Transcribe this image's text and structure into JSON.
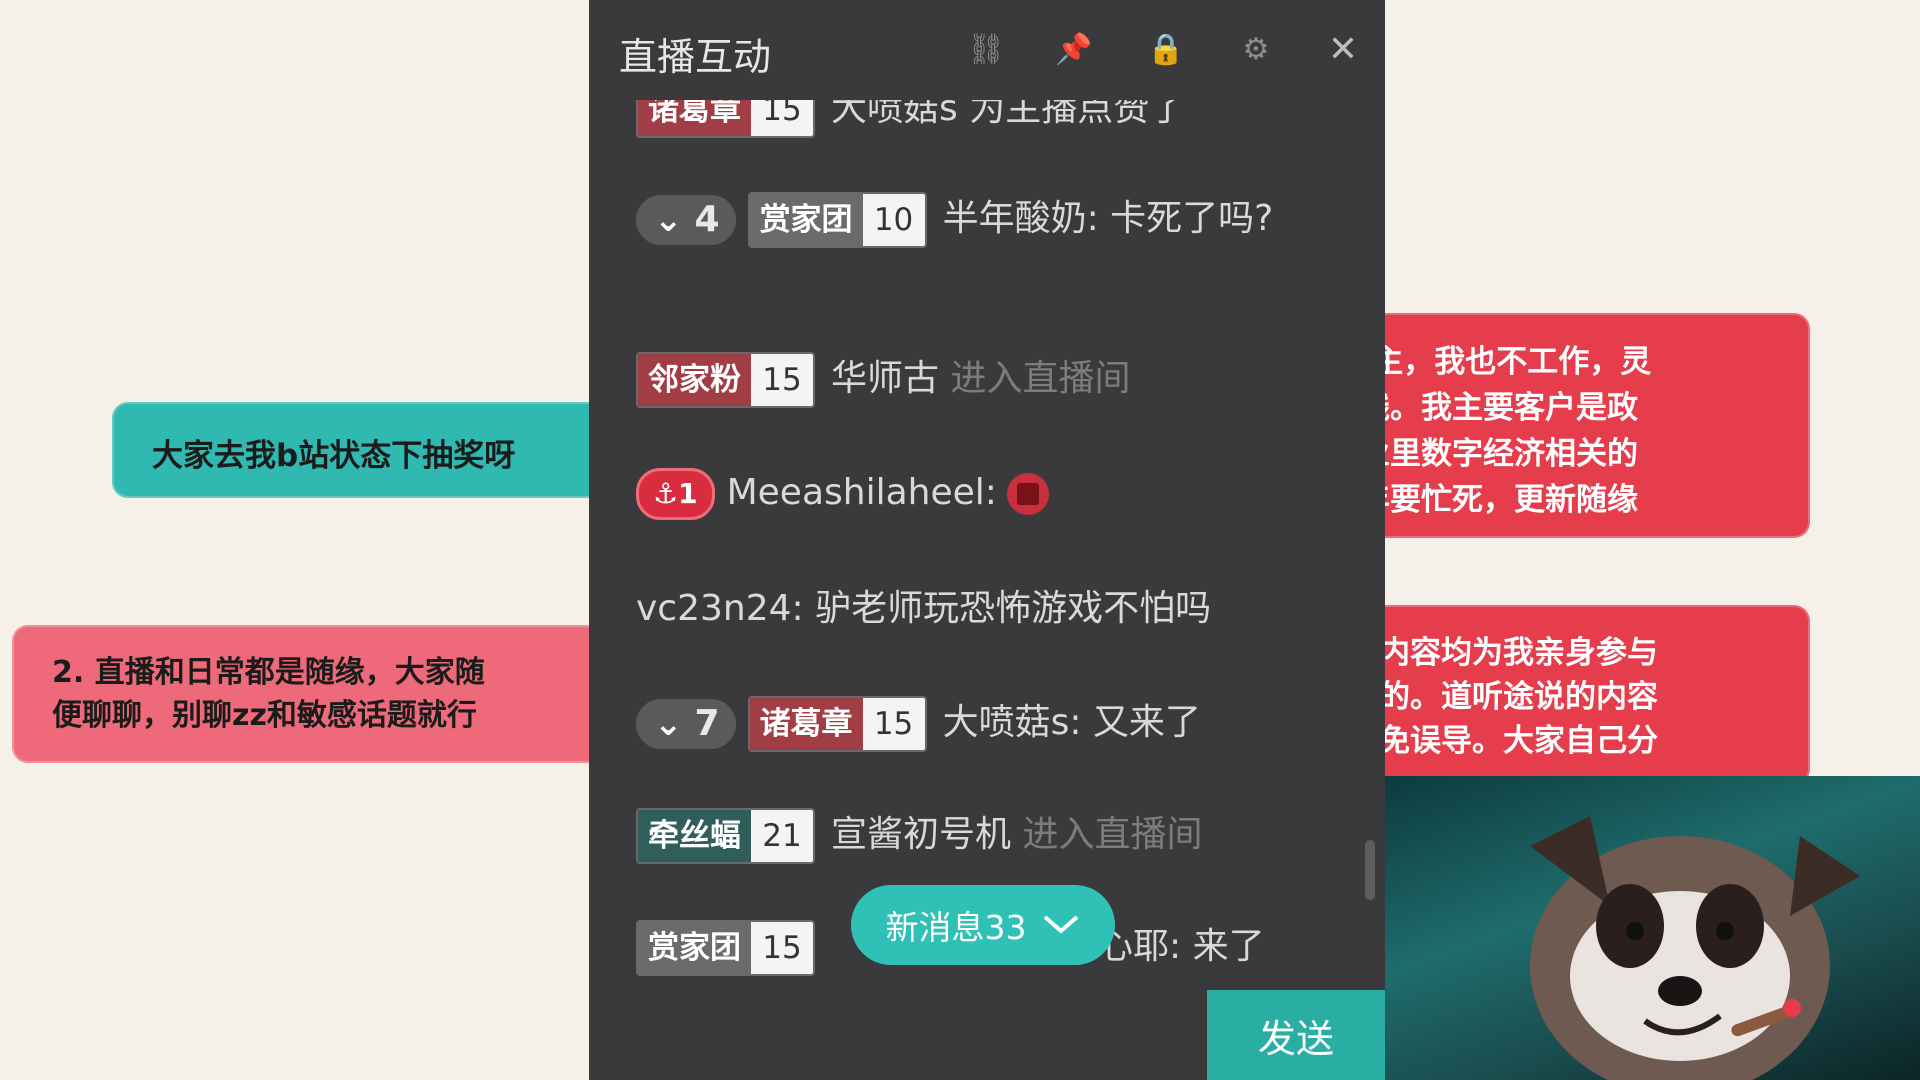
{
  "background": {
    "teal_banner": "大家去我b站状态下抽奖呀",
    "pink_banner": "2. 直播和日常都是随缘，大家随\n便聊聊，别聊zz和敏感话题就行",
    "red_box_1": "up主，我也不工作，灵\n一线。我主要客户是政\n企业里数字经济相关的\n明年要忙死，更新随缘",
    "red_box_2": "新内容均为我亲身参与\n与的。道听途说的内容\n以免误导。大家自己分"
  },
  "panel": {
    "title": "直播互动",
    "icons": [
      "link-icon",
      "pin-icon",
      "lock-icon",
      "gear-icon",
      "close-icon"
    ],
    "messages": {
      "m0": {
        "medal": "诸葛章",
        "medal_level": "15",
        "text": "大喷菇s 为主播点赞了"
      },
      "m1": {
        "user_level": "4",
        "medal": "赏家团",
        "medal_level": "10",
        "text": "半年酸奶: 卡死了吗?"
      },
      "m2": {
        "medal": "邻家粉",
        "medal_level": "15",
        "user": "华师古",
        "action": "进入直播间"
      },
      "m3": {
        "badge": "1",
        "text": "Meeashilaheel:"
      },
      "m4": {
        "text": "vc23n24: 驴老师玩恐怖游戏不怕吗"
      },
      "m5": {
        "user_level": "7",
        "medal": "诸葛章",
        "medal_level": "15",
        "text": "大喷菇s: 又来了"
      },
      "m6": {
        "medal": "牵丝蝠",
        "medal_level": "21",
        "user": "宣酱初号机",
        "action": "进入直播间"
      },
      "m7": {
        "medal": "赏家团",
        "medal_level": "15",
        "text": "开心耶: 来了"
      }
    },
    "new_messages": "新消息33",
    "send": "发送"
  },
  "colors": {
    "accent": "#2fc1b5",
    "panel_bg": "#3a3a3d",
    "red": "#e63d4c",
    "teal": "#2fb9b0"
  }
}
